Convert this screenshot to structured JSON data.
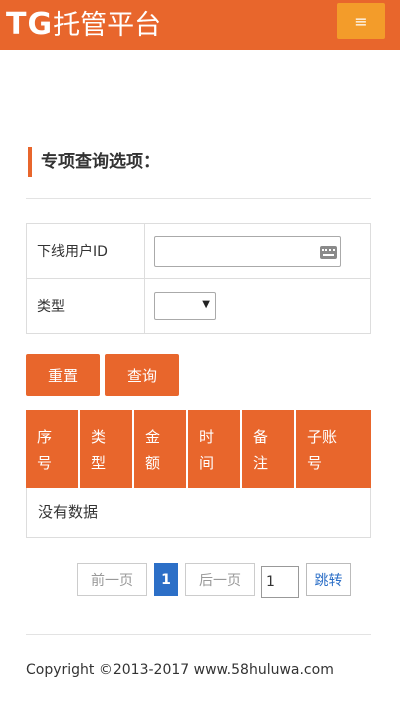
{
  "header": {
    "logo_tg": "TG",
    "logo_text": "托管平台",
    "menu_icon": "hamburger-icon",
    "menu_glyph": "≡"
  },
  "section": {
    "title": "专项查询选项："
  },
  "form": {
    "user_id_label": "下线用户ID",
    "user_id_value": "",
    "keyboard_icon": "keyboard-icon",
    "type_label": "类型",
    "type_selected": "",
    "type_arrow": "▼"
  },
  "buttons": {
    "reset": "重置",
    "query": "查询"
  },
  "table": {
    "columns": [
      {
        "l1": "序",
        "l2": "号"
      },
      {
        "l1": "类",
        "l2": "型"
      },
      {
        "l1": "金",
        "l2": "额"
      },
      {
        "l1": "时",
        "l2": "间"
      },
      {
        "l1": "备",
        "l2": "注"
      },
      {
        "l1": "子账",
        "l2": "号"
      }
    ],
    "empty_text": "没有数据"
  },
  "pager": {
    "prev": "前一页",
    "current": "1",
    "next": "后一页",
    "page_input": "1",
    "jump": "跳转"
  },
  "footer": {
    "copyright": "Copyright ©2013-2017 www.58huluwa.com"
  },
  "colors": {
    "accent": "#e8662c",
    "menu": "#f39c2a",
    "pager_active": "#2c6fc7"
  }
}
